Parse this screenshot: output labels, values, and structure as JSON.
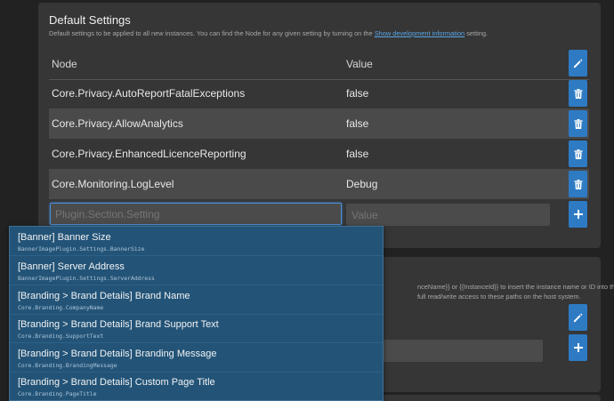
{
  "default_settings": {
    "title": "Default Settings",
    "description_prefix": "Default settings to be applied to all new instances. You can find the Node for any given setting by turning on the",
    "description_link": "Show development information",
    "description_suffix": "setting.",
    "columns": {
      "node": "Node",
      "value": "Value"
    },
    "rows": [
      {
        "node": "Core.Privacy.AutoReportFatalExceptions",
        "value": "false"
      },
      {
        "node": "Core.Privacy.AllowAnalytics",
        "value": "false"
      },
      {
        "node": "Core.Privacy.EnhancedLicenceReporting",
        "value": "false"
      },
      {
        "node": "Core.Monitoring.LogLevel",
        "value": "Debug"
      }
    ],
    "new_node_placeholder": "Plugin.Section.Setting",
    "new_value_placeholder": "Value"
  },
  "second_panel": {
    "desc_line1": "nceName}} or {{InstanceId}} to insert the instance name or ID into the",
    "desc_line2": "full read/write access to these paths on the host system."
  },
  "dropdown": {
    "options": [
      {
        "title": "[Banner] Banner Size",
        "node": "BannerImagePlugin.Settings.BannerSize"
      },
      {
        "title": "[Banner] Server Address",
        "node": "BannerImagePlugin.Settings.ServerAddress"
      },
      {
        "title": "[Branding > Brand Details] Brand Name",
        "node": "Core.Branding.CompanyName"
      },
      {
        "title": "[Branding > Brand Details] Brand Support Text",
        "node": "Core.Branding.SupportText"
      },
      {
        "title": "[Branding > Brand Details] Branding Message",
        "node": "Core.Branding.BrandingMessage"
      },
      {
        "title": "[Branding > Brand Details] Custom Page Title",
        "node": "Core.Branding.PageTitle"
      }
    ]
  },
  "icons": {
    "edit": "pencil-icon",
    "delete": "trash-icon",
    "add": "plus-icon"
  },
  "colors": {
    "accent": "#2e7bc4",
    "dropdown_bg": "#235478",
    "link": "#5aa6e6"
  }
}
